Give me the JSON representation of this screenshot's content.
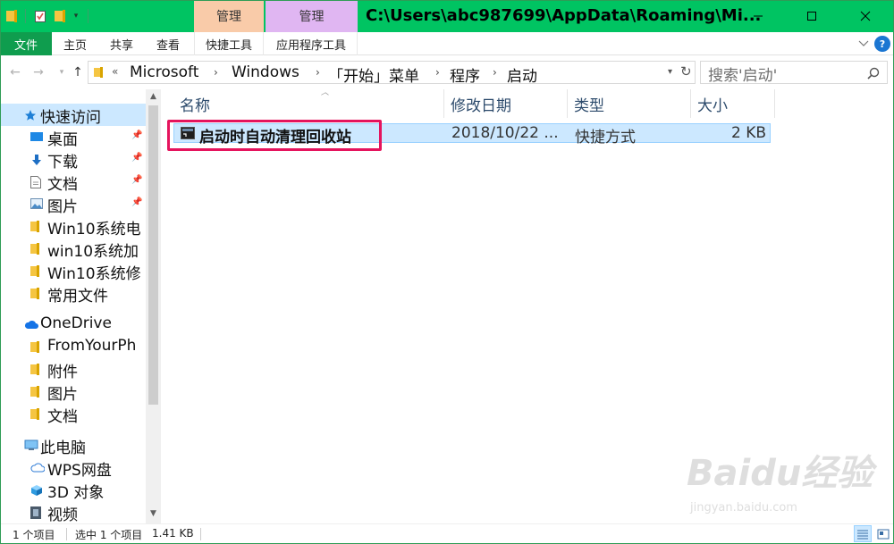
{
  "window": {
    "title": "C:\\Users\\abc987699\\AppData\\Roaming\\Mi...",
    "context_tabs": [
      "管理",
      "管理"
    ],
    "controls": {
      "minimize": "—",
      "maximize": "☐",
      "close": "✕"
    }
  },
  "ribbon": {
    "tabs": [
      "文件",
      "主页",
      "共享",
      "查看",
      "快捷工具",
      "应用程序工具"
    ],
    "help": "?"
  },
  "address": {
    "overflow": "«",
    "crumbs": [
      "Microsoft",
      "Windows",
      "「开始」菜单",
      "程序",
      "启动"
    ],
    "search_placeholder": "搜索'启动'"
  },
  "nav": {
    "quick_access": "快速访问",
    "quick_items": [
      "桌面",
      "下载",
      "文档",
      "图片",
      "Win10系统电",
      "win10系统加",
      "Win10系统修",
      "常用文件"
    ],
    "onedrive": "OneDrive",
    "onedrive_items": [
      "FromYourPh",
      "附件",
      "图片",
      "文档"
    ],
    "this_pc": "此电脑",
    "pc_items": [
      "WPS网盘",
      "3D 对象",
      "视频"
    ]
  },
  "columns": {
    "name": "名称",
    "date": "修改日期",
    "type": "类型",
    "size": "大小"
  },
  "files": [
    {
      "name": "启动时自动清理回收站",
      "date": "2018/10/22 ...",
      "type": "快捷方式",
      "size": "2 KB"
    }
  ],
  "status": {
    "count": "1 个项目",
    "selected": "选中 1 个项目",
    "size": "1.41 KB"
  },
  "watermark": {
    "brand": "Baidu经验",
    "url": "jingyan.baidu.com"
  },
  "colors": {
    "titlebar": "#00c462",
    "file_tab": "#0f9d4e",
    "selection": "#cce8ff",
    "highlight_box": "#e5145d",
    "ctx_tab_1": "#f9cba9",
    "ctx_tab_2": "#e0b6f2"
  }
}
